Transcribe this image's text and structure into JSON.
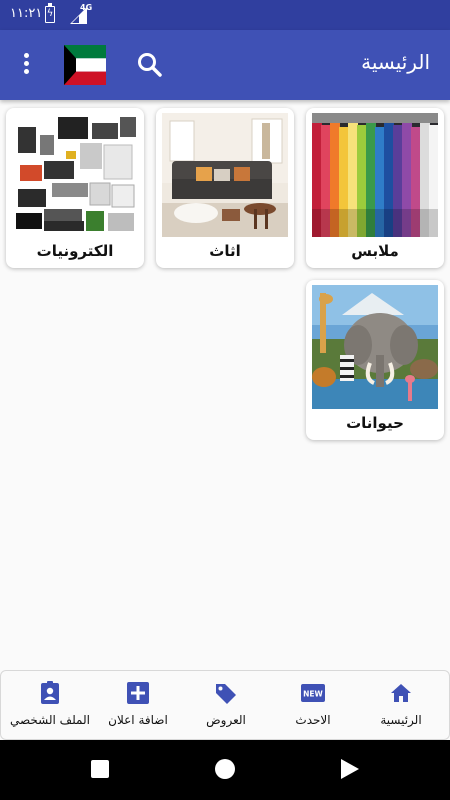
{
  "status_bar": {
    "time": "١١:٢١",
    "network": "4G",
    "battery_icon": "battery-charging-icon",
    "signal_icon": "signal-icon"
  },
  "app_bar": {
    "title": "الرئيسية",
    "menu_icon": "more-vert-icon",
    "flag_icon": "kuwait-flag-icon",
    "search_icon": "search-icon",
    "background_color": "#3f51b5",
    "status_color": "#303f9f"
  },
  "categories": [
    {
      "label": "ملابس",
      "image": "clothes-rack-image"
    },
    {
      "label": "اثاث",
      "image": "living-room-furniture-image"
    },
    {
      "label": "الكترونيات",
      "image": "electronics-collection-image"
    },
    {
      "label": "حيوانات",
      "image": "wild-animals-image"
    }
  ],
  "bottom_nav": {
    "accent_color": "#3f51b5",
    "items": [
      {
        "label": "الرئيسية",
        "icon": "home-icon"
      },
      {
        "label": "الاحدث",
        "icon": "new-badge-icon",
        "badge_text": "NEW"
      },
      {
        "label": "العروض",
        "icon": "tag-icon"
      },
      {
        "label": "اضافة اعلان",
        "icon": "add-box-icon"
      },
      {
        "label": "الملف الشخصي",
        "icon": "profile-badge-icon"
      }
    ]
  },
  "system_nav": {
    "recents_icon": "recents-square-icon",
    "home_icon": "home-circle-icon",
    "back_icon": "back-triangle-icon"
  }
}
